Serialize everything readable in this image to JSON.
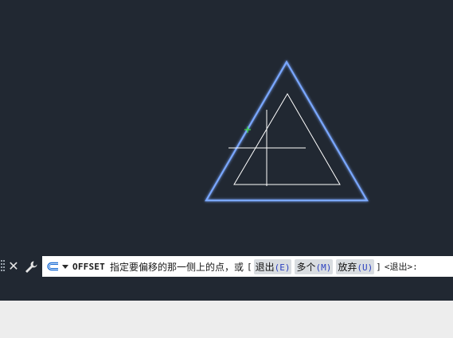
{
  "command_line": {
    "command_name": "OFFSET",
    "prompt": "指定要偏移的那一侧上的点，或",
    "bracket_open": "[",
    "bracket_close": "]",
    "options": [
      {
        "label": "退出",
        "key": "(E)"
      },
      {
        "label": "多个",
        "key": "(M)"
      },
      {
        "label": "放弃",
        "key": "(U)"
      }
    ],
    "default_value": "<退出>:"
  },
  "icons": {
    "close": "close-icon",
    "customize": "wrench-icon",
    "command_history": "command-prompt-icon",
    "dropdown": "chevron-down-icon"
  },
  "colors": {
    "canvas_background": "#212832",
    "selected_object": "#7aa7ff",
    "offset_preview": "#ffffff",
    "crosshair": "#ffffff",
    "snap_marker": "#3fdc3f",
    "command_line_background": "#ffffff",
    "option_highlight": "#d9dde1",
    "option_key": "#2a3fbf"
  }
}
